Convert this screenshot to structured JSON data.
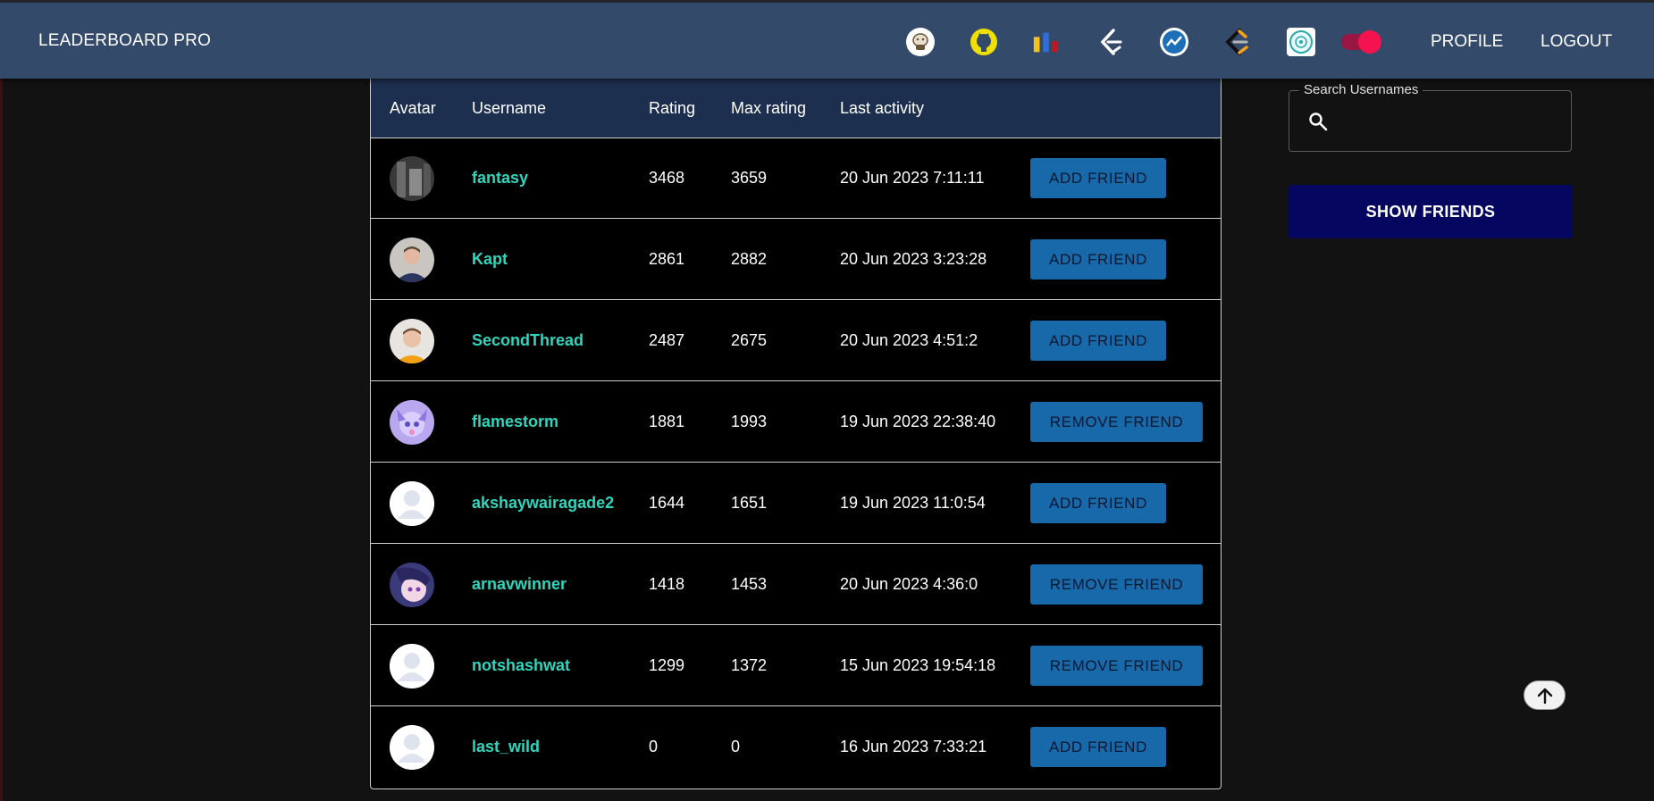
{
  "app": {
    "brand": "LEADERBOARD PRO"
  },
  "nav": {
    "icons": [
      "codechef-icon",
      "github-icon",
      "stats-bars-icon",
      "leetcode-icon",
      "codeforces-icon",
      "leetcode-orange-icon",
      "atcoder-icon"
    ],
    "theme_toggle": "on",
    "profile_label": "PROFILE",
    "logout_label": "LOGOUT"
  },
  "table": {
    "headers": {
      "avatar": "Avatar",
      "username": "Username",
      "rating": "Rating",
      "max_rating": "Max rating",
      "last_activity": "Last activity"
    },
    "rows": [
      {
        "avatar": "photo-avatar",
        "username": "fantasy",
        "rating": "3468",
        "max_rating": "3659",
        "last_activity": "20 Jun 2023 7:11:11",
        "action": "ADD FRIEND"
      },
      {
        "avatar": "photo-avatar",
        "username": "Kapt",
        "rating": "2861",
        "max_rating": "2882",
        "last_activity": "20 Jun 2023 3:23:28",
        "action": "ADD FRIEND"
      },
      {
        "avatar": "photo-avatar",
        "username": "SecondThread",
        "rating": "2487",
        "max_rating": "2675",
        "last_activity": "20 Jun 2023 4:51:2",
        "action": "ADD FRIEND"
      },
      {
        "avatar": "anime-avatar",
        "username": "flamestorm",
        "rating": "1881",
        "max_rating": "1993",
        "last_activity": "19 Jun 2023 22:38:40",
        "action": "REMOVE FRIEND"
      },
      {
        "avatar": "default-avatar",
        "username": "akshaywairagade2",
        "rating": "1644",
        "max_rating": "1651",
        "last_activity": "19 Jun 2023 11:0:54",
        "action": "ADD FRIEND"
      },
      {
        "avatar": "anime-avatar",
        "username": "arnavwinner",
        "rating": "1418",
        "max_rating": "1453",
        "last_activity": "20 Jun 2023 4:36:0",
        "action": "REMOVE FRIEND"
      },
      {
        "avatar": "default-avatar",
        "username": "notshashwat",
        "rating": "1299",
        "max_rating": "1372",
        "last_activity": "15 Jun 2023 19:54:18",
        "action": "REMOVE FRIEND"
      },
      {
        "avatar": "default-avatar",
        "username": "last_wild",
        "rating": "0",
        "max_rating": "0",
        "last_activity": "16 Jun 2023 7:33:21",
        "action": "ADD FRIEND"
      }
    ]
  },
  "sidebar": {
    "search_label": "Search Usernames",
    "search_value": "",
    "show_friends_label": "SHOW FRIENDS"
  },
  "colors": {
    "navbar": "#344a6b",
    "table_header": "#1d2f4f",
    "username": "#2fd6bd",
    "button": "#1769aa",
    "show_friends": "#05065f",
    "toggle": "#f5134f"
  }
}
